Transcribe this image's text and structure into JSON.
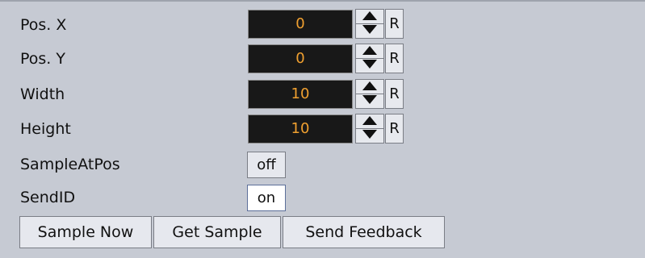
{
  "fields": [
    {
      "label": "Pos. X",
      "value": "0",
      "reset_label": "R"
    },
    {
      "label": "Pos. Y",
      "value": "0",
      "reset_label": "R"
    },
    {
      "label": "Width",
      "value": "10",
      "reset_label": "R"
    },
    {
      "label": "Height",
      "value": "10",
      "reset_label": "R"
    }
  ],
  "toggles": [
    {
      "label": "SampleAtPos",
      "state": "off"
    },
    {
      "label": "SendID",
      "state": "on"
    }
  ],
  "buttons": {
    "sample_now": "Sample Now",
    "get_sample": "Get Sample",
    "send_feedback": "Send Feedback"
  },
  "colors": {
    "background": "#c6cad3",
    "field_bg": "#181818",
    "field_text": "#f0a030"
  },
  "icons": {
    "spin_up": "triangle-up-icon",
    "spin_down": "triangle-down-icon"
  }
}
